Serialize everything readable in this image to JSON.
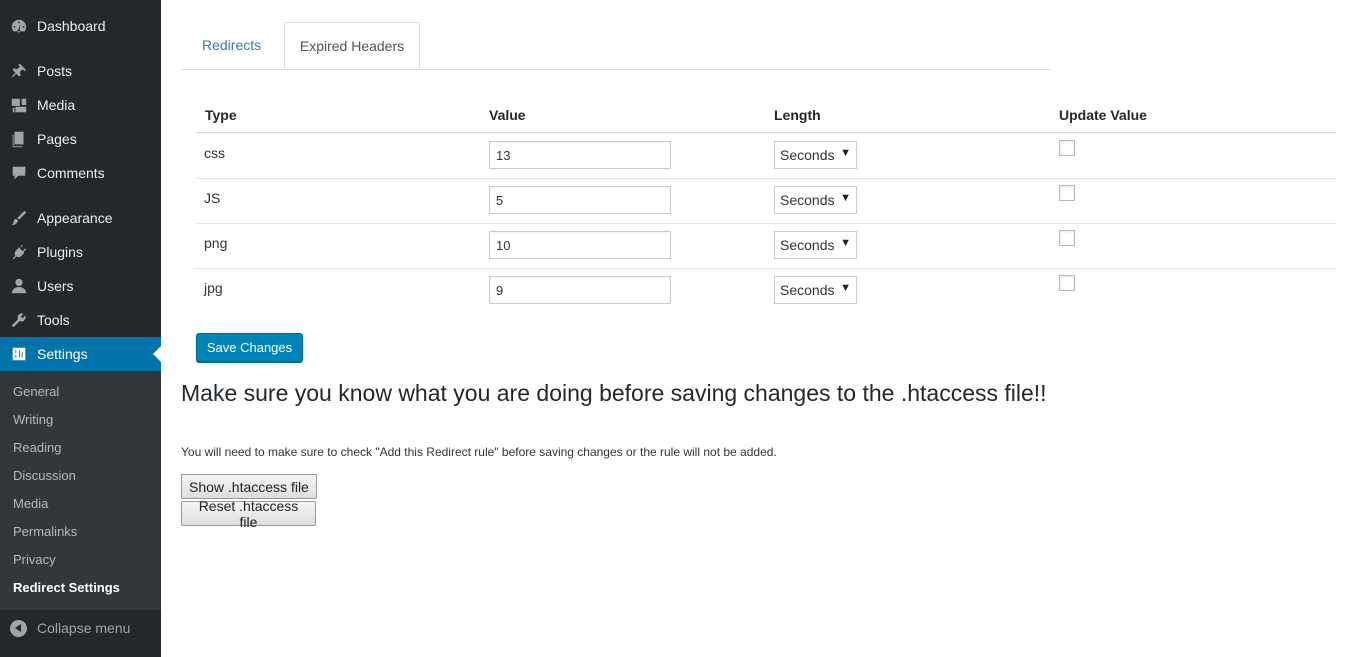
{
  "sidebar": {
    "items": [
      {
        "label": "Dashboard",
        "icon": "dashboard-icon"
      },
      {
        "label": "Posts",
        "icon": "pin-icon"
      },
      {
        "label": "Media",
        "icon": "media-icon"
      },
      {
        "label": "Pages",
        "icon": "pages-icon"
      },
      {
        "label": "Comments",
        "icon": "comment-icon"
      },
      {
        "label": "Appearance",
        "icon": "brush-icon"
      },
      {
        "label": "Plugins",
        "icon": "plugin-icon"
      },
      {
        "label": "Users",
        "icon": "user-icon"
      },
      {
        "label": "Tools",
        "icon": "wrench-icon"
      },
      {
        "label": "Settings",
        "icon": "settings-icon"
      }
    ],
    "submenu": [
      "General",
      "Writing",
      "Reading",
      "Discussion",
      "Media",
      "Permalinks",
      "Privacy",
      "Redirect Settings"
    ],
    "collapse_label": "Collapse menu",
    "active_color": "#0073aa"
  },
  "tabs": {
    "redirects": "Redirects",
    "expired_headers": "Expired Headers"
  },
  "table": {
    "headers": [
      "Type",
      "Value",
      "Length",
      "Update Value"
    ],
    "rows": [
      {
        "type": "css",
        "value": "13",
        "length": "Seconds",
        "checked": false
      },
      {
        "type": "JS",
        "value": "5",
        "length": "Seconds",
        "checked": false
      },
      {
        "type": "png",
        "value": "10",
        "length": "Seconds",
        "checked": false
      },
      {
        "type": "jpg",
        "value": "9",
        "length": "Seconds",
        "checked": false
      }
    ]
  },
  "save_button": "Save Changes",
  "warning": "Make sure you know what you are doing before saving changes to the .htaccess file!!",
  "note": "You will need to make sure to check \"Add this Redirect rule\" before saving changes or the rule will not be added.",
  "show_button": "Show .htaccess file",
  "reset_button": "Reset .htaccess file"
}
